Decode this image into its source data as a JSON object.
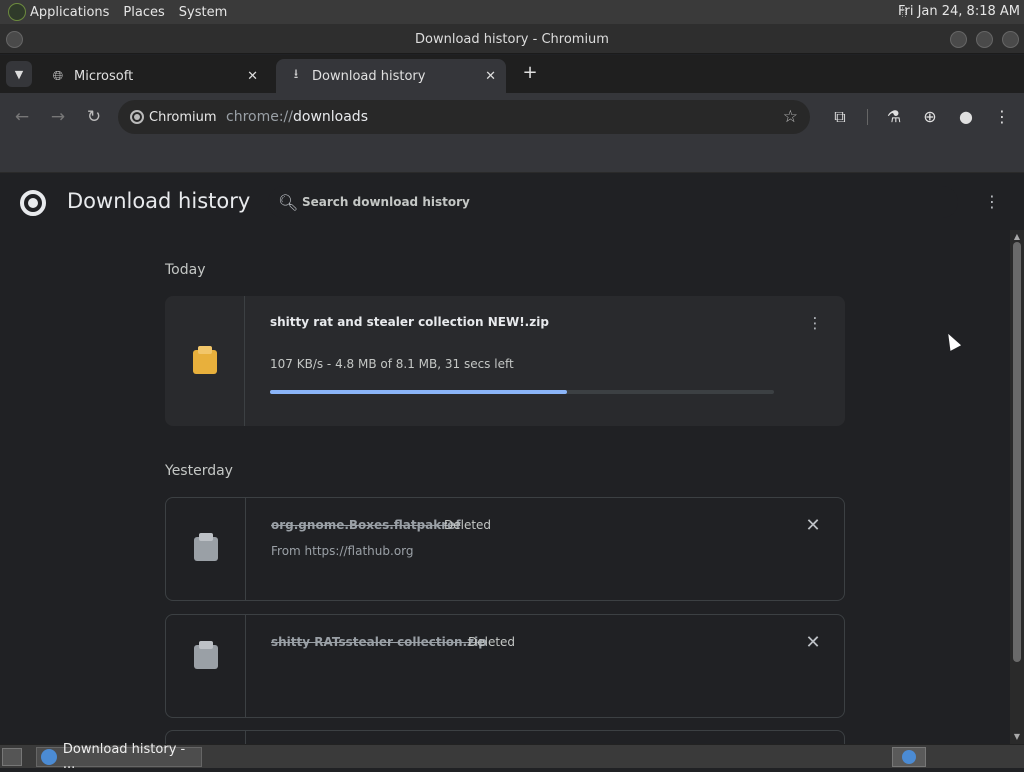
{
  "desktop": {
    "menus": [
      "Applications",
      "Places",
      "System"
    ],
    "clock": "Fri Jan 24,  8:18 AM"
  },
  "window": {
    "title": "Download history - Chromium"
  },
  "tabs": [
    {
      "label": "Microsoft",
      "icon": "globe-icon",
      "active": false
    },
    {
      "label": "Download history",
      "icon": "download-icon",
      "active": true
    }
  ],
  "omnibox": {
    "chip_label": "Chromium",
    "url_scheme": "chrome://",
    "url_host": "downloads"
  },
  "page": {
    "title": "Download history",
    "search_placeholder": "Search download history"
  },
  "sections": {
    "today": "Today",
    "yesterday": "Yesterday"
  },
  "downloads": [
    {
      "filename": "shitty rat and stealer collection NEW!.zip",
      "progress_text": "107 KB/s - 4.8 MB of 8.1 MB, 31 secs left",
      "progress_fraction": 0.59,
      "icon": "zip-file-icon"
    },
    {
      "filename": "org.gnome.Boxes.flatpakref",
      "status": "Deleted",
      "source": "From https://flathub.org",
      "icon": "file-icon"
    },
    {
      "filename": "shitty RATsstealer collection.zip",
      "status": "Deleted",
      "icon": "file-icon"
    }
  ],
  "taskbar": {
    "task_label": "Download history - ..."
  },
  "colors": {
    "accent": "#8ab4f8",
    "page_bg": "#202124",
    "card_bg": "#292a2d"
  }
}
